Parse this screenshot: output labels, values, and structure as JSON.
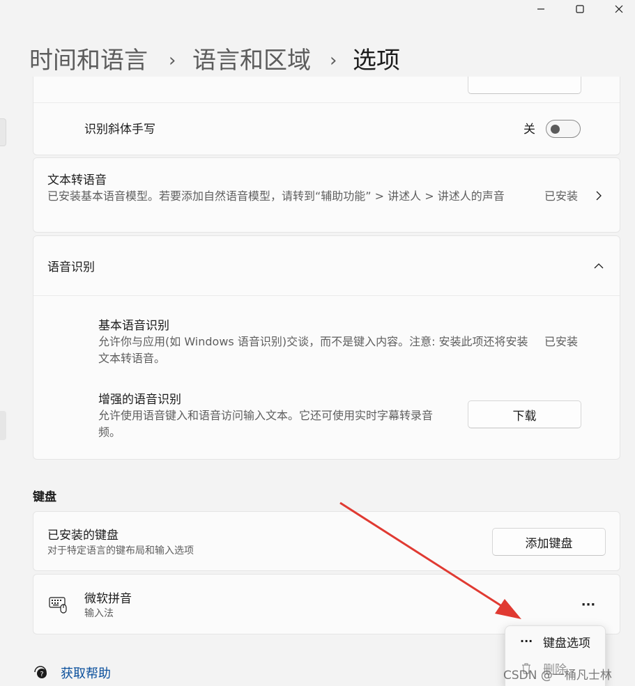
{
  "window": {
    "minimize_icon": "minimize-icon",
    "maximize_icon": "maximize-icon",
    "close_icon": "close-icon"
  },
  "breadcrumb": {
    "items": [
      "时间和语言",
      "语言和区域",
      "选项"
    ],
    "separator": "›"
  },
  "handwriting": {
    "label": "识别斜体手写",
    "toggle_state": "关"
  },
  "tts": {
    "title": "文本转语音",
    "desc": "已安装基本语音模型。若要添加自然语音模型，请转到“辅助功能” > 讲述人 > 讲述人的声音",
    "status": "已安装"
  },
  "speech": {
    "title": "语音识别",
    "basic": {
      "title": "基本语音识别",
      "desc": "允许你与应用(如 Windows 语音识别)交谈，而不是键入内容。注意: 安装此项还将安装文本转语音。",
      "status": "已安装"
    },
    "enhanced": {
      "title": "增强的语音识别",
      "desc": "允许使用语音键入和语音访问输入文本。它还可使用实时字幕转录音频。",
      "button": "下载"
    }
  },
  "keyboard": {
    "section_title": "键盘",
    "installed_title": "已安装的键盘",
    "installed_desc": "对于特定语言的键布局和输入选项",
    "add_button": "添加键盘",
    "ime": {
      "name": "微软拼音",
      "type": "输入法",
      "more": "···"
    }
  },
  "context_menu": {
    "items": [
      {
        "label": "键盘选项",
        "icon": "more-icon"
      },
      {
        "label": "删除",
        "icon": "trash-icon"
      }
    ]
  },
  "help": {
    "label": "获取帮助"
  },
  "watermark": "CSDN @一桶凡士林",
  "colors": {
    "accent_link": "#0a4f9c",
    "arrow_red": "#e03a32",
    "card_bg": "#fbfbfb",
    "page_bg": "#f3f3f3"
  }
}
